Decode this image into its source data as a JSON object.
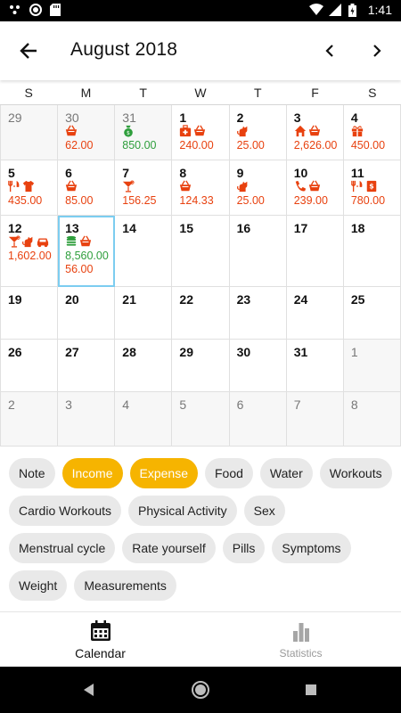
{
  "status_bar": {
    "time": "1:41"
  },
  "header": {
    "title": "August 2018"
  },
  "weekdays": [
    "S",
    "M",
    "T",
    "W",
    "T",
    "F",
    "S"
  ],
  "colors": {
    "expense": "#e8410f",
    "income": "#2e9e3c",
    "accent": "#f6b400",
    "today_border": "#7ccdf0"
  },
  "calendar": {
    "days": [
      {
        "day": "29",
        "other": true,
        "icons": [],
        "amounts": []
      },
      {
        "day": "30",
        "other": true,
        "icons": [
          "basket-icon"
        ],
        "amounts": [
          {
            "v": "62.00",
            "c": "red"
          }
        ]
      },
      {
        "day": "31",
        "other": true,
        "icons": [
          "money-bag-icon"
        ],
        "amounts": [
          {
            "v": "850.00",
            "c": "green"
          }
        ]
      },
      {
        "day": "1",
        "icons": [
          "medkit-icon",
          "basket-icon"
        ],
        "amounts": [
          {
            "v": "240.00",
            "c": "red"
          }
        ]
      },
      {
        "day": "2",
        "icons": [
          "pet-icon"
        ],
        "amounts": [
          {
            "v": "25.00",
            "c": "red"
          }
        ]
      },
      {
        "day": "3",
        "icons": [
          "home-icon",
          "basket-icon"
        ],
        "amounts": [
          {
            "v": "2,626.00",
            "c": "red"
          }
        ]
      },
      {
        "day": "4",
        "icons": [
          "gift-icon"
        ],
        "amounts": [
          {
            "v": "450.00",
            "c": "red"
          }
        ]
      },
      {
        "day": "5",
        "icons": [
          "dining-icon",
          "shirt-icon"
        ],
        "amounts": [
          {
            "v": "435.00",
            "c": "red"
          }
        ]
      },
      {
        "day": "6",
        "icons": [
          "basket-icon"
        ],
        "amounts": [
          {
            "v": "85.00",
            "c": "red"
          }
        ]
      },
      {
        "day": "7",
        "icons": [
          "cocktail-icon"
        ],
        "amounts": [
          {
            "v": "156.25",
            "c": "red"
          }
        ]
      },
      {
        "day": "8",
        "icons": [
          "basket-icon"
        ],
        "amounts": [
          {
            "v": "124.33",
            "c": "red"
          }
        ]
      },
      {
        "day": "9",
        "icons": [
          "pet-icon"
        ],
        "amounts": [
          {
            "v": "25.00",
            "c": "red"
          }
        ]
      },
      {
        "day": "10",
        "icons": [
          "phone-icon",
          "basket-icon"
        ],
        "amounts": [
          {
            "v": "239.00",
            "c": "red"
          }
        ]
      },
      {
        "day": "11",
        "icons": [
          "dining-icon",
          "bill-icon"
        ],
        "amounts": [
          {
            "v": "780.00",
            "c": "red"
          }
        ]
      },
      {
        "day": "12",
        "icons": [
          "cocktail-icon",
          "pet-icon",
          "car-icon"
        ],
        "amounts": [
          {
            "v": "1,602.00",
            "c": "red"
          }
        ]
      },
      {
        "day": "13",
        "today": true,
        "icons": [
          "coins-icon",
          "basket-icon"
        ],
        "amounts": [
          {
            "v": "8,560.00",
            "c": "green"
          },
          {
            "v": "56.00",
            "c": "red"
          }
        ]
      },
      {
        "day": "14",
        "icons": [],
        "amounts": []
      },
      {
        "day": "15",
        "icons": [],
        "amounts": []
      },
      {
        "day": "16",
        "icons": [],
        "amounts": []
      },
      {
        "day": "17",
        "icons": [],
        "amounts": []
      },
      {
        "day": "18",
        "icons": [],
        "amounts": []
      },
      {
        "day": "19",
        "icons": [],
        "amounts": []
      },
      {
        "day": "20",
        "icons": [],
        "amounts": []
      },
      {
        "day": "21",
        "icons": [],
        "amounts": []
      },
      {
        "day": "22",
        "icons": [],
        "amounts": []
      },
      {
        "day": "23",
        "icons": [],
        "amounts": []
      },
      {
        "day": "24",
        "icons": [],
        "amounts": []
      },
      {
        "day": "25",
        "icons": [],
        "amounts": []
      },
      {
        "day": "26",
        "icons": [],
        "amounts": []
      },
      {
        "day": "27",
        "icons": [],
        "amounts": []
      },
      {
        "day": "28",
        "icons": [],
        "amounts": []
      },
      {
        "day": "29",
        "icons": [],
        "amounts": []
      },
      {
        "day": "30",
        "icons": [],
        "amounts": []
      },
      {
        "day": "31",
        "icons": [],
        "amounts": []
      },
      {
        "day": "1",
        "other": true,
        "icons": [],
        "amounts": []
      },
      {
        "day": "2",
        "other": true,
        "icons": [],
        "amounts": []
      },
      {
        "day": "3",
        "other": true,
        "icons": [],
        "amounts": []
      },
      {
        "day": "4",
        "other": true,
        "icons": [],
        "amounts": []
      },
      {
        "day": "5",
        "other": true,
        "icons": [],
        "amounts": []
      },
      {
        "day": "6",
        "other": true,
        "icons": [],
        "amounts": []
      },
      {
        "day": "7",
        "other": true,
        "icons": [],
        "amounts": []
      },
      {
        "day": "8",
        "other": true,
        "icons": [],
        "amounts": []
      }
    ]
  },
  "filters": [
    {
      "label": "Note",
      "active": false
    },
    {
      "label": "Income",
      "active": true
    },
    {
      "label": "Expense",
      "active": true
    },
    {
      "label": "Food",
      "active": false
    },
    {
      "label": "Water",
      "active": false
    },
    {
      "label": "Workouts",
      "active": false
    },
    {
      "label": "Cardio Workouts",
      "active": false
    },
    {
      "label": "Physical Activity",
      "active": false
    },
    {
      "label": "Sex",
      "active": false
    },
    {
      "label": "Menstrual cycle",
      "active": false
    },
    {
      "label": "Rate yourself",
      "active": false
    },
    {
      "label": "Pills",
      "active": false
    },
    {
      "label": "Symptoms",
      "active": false
    },
    {
      "label": "Weight",
      "active": false
    },
    {
      "label": "Measurements",
      "active": false
    }
  ],
  "bottom_nav": {
    "calendar_label": "Calendar",
    "statistics_label": "Statistics"
  }
}
